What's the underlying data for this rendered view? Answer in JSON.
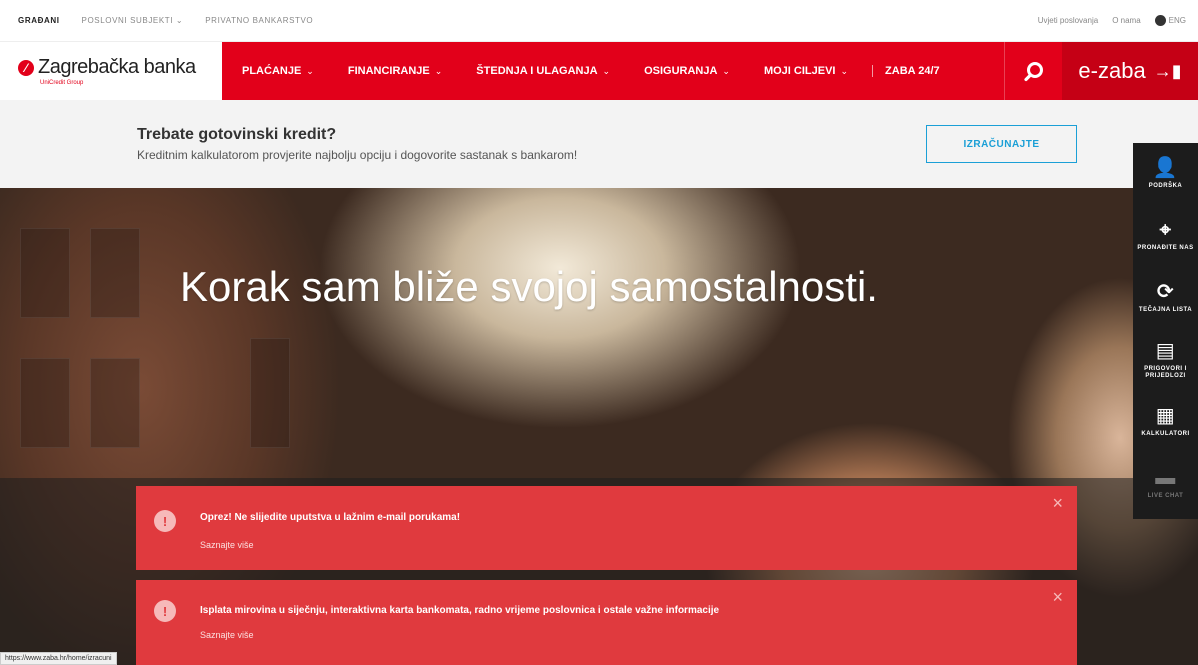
{
  "topbar": {
    "items": [
      "GRAĐANI",
      "POSLOVNI SUBJEKTI",
      "PRIVATNO BANKARSTVO"
    ],
    "right": [
      "Uvjeti poslovanja",
      "O nama",
      "ENG"
    ]
  },
  "brand": {
    "name": "Zagrebačka banka",
    "sub": "UniCredit Group"
  },
  "nav": {
    "items": [
      "PLAĆANJE",
      "FINANCIRANJE",
      "ŠTEDNJA I ULAGANJA",
      "OSIGURANJA",
      "MOJI CILJEVI"
    ],
    "zaba": "ZABA 24/7",
    "ezaba": "e-zaba"
  },
  "promo": {
    "heading": "Trebate gotovinski kredit?",
    "text": "Kreditnim kalkulatorom provjerite najbolju opciju i dogovorite sastanak s bankarom!",
    "button": "IZRAČUNAJTE"
  },
  "hero": {
    "title": "Korak sam bliže svojoj samostalnosti."
  },
  "side": {
    "items": [
      {
        "label": "PODRŠKA",
        "icon": "support-icon"
      },
      {
        "label": "PRONAĐITE NAS",
        "icon": "map-pin-icon"
      },
      {
        "label": "TEČAJNA LISTA",
        "icon": "exchange-icon"
      },
      {
        "label": "PRIGOVORI I PRIJEDLOZI",
        "icon": "document-icon"
      },
      {
        "label": "KALKULATORI",
        "icon": "calculator-icon"
      },
      {
        "label": "LIVE CHAT",
        "icon": "chat-icon"
      }
    ]
  },
  "alerts": [
    {
      "message": "Oprez! Ne slijedite uputstva u lažnim e-mail porukama!",
      "link": "Saznajte više"
    },
    {
      "message": "Isplata mirovina u siječnju, interaktivna karta bankomata, radno vrijeme poslovnica i ostale važne informacije",
      "link": "Saznajte više"
    }
  ],
  "status_url": "https://www.zaba.hr/home/izracuni",
  "colors": {
    "brand_red": "#e2001a",
    "alert_red": "#e03a3e",
    "accent_blue": "#1a9fd6"
  }
}
